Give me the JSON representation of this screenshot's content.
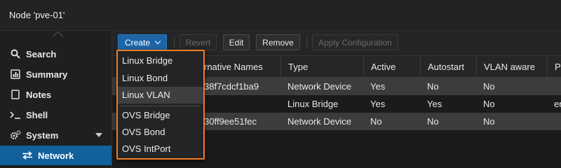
{
  "window": {
    "title": "Node 'pve-01'"
  },
  "sidebar": {
    "items": [
      {
        "label": "Search",
        "icon": "search-icon"
      },
      {
        "label": "Summary",
        "icon": "summary-icon"
      },
      {
        "label": "Notes",
        "icon": "notes-icon"
      },
      {
        "label": "Shell",
        "icon": "terminal-icon"
      },
      {
        "label": "System",
        "icon": "gears-icon"
      },
      {
        "label": "Network",
        "icon": "network-icon"
      }
    ]
  },
  "toolbar": {
    "create": "Create",
    "revert": "Revert",
    "edit": "Edit",
    "remove": "Remove",
    "apply": "Apply Configuration"
  },
  "grid": {
    "columns": [
      "rnative Names",
      "Type",
      "Active",
      "Autostart",
      "VLAN aware",
      "Po"
    ],
    "rows": [
      [
        "38f7cdcf1ba9",
        "Network Device",
        "Yes",
        "No",
        "No",
        ""
      ],
      [
        "",
        "Linux Bridge",
        "Yes",
        "Yes",
        "No",
        "en"
      ],
      [
        "30ff9ee51fec",
        "Network Device",
        "No",
        "No",
        "No",
        ""
      ]
    ]
  },
  "create_menu": {
    "items": [
      "Linux Bridge",
      "Linux Bond",
      "Linux VLAN",
      "OVS Bridge",
      "OVS Bond",
      "OVS IntPort"
    ],
    "highlighted": "Linux VLAN"
  },
  "colors": {
    "accent": "#1d65a6",
    "menu_border": "#f07b25",
    "active_nav": "#12609c"
  }
}
